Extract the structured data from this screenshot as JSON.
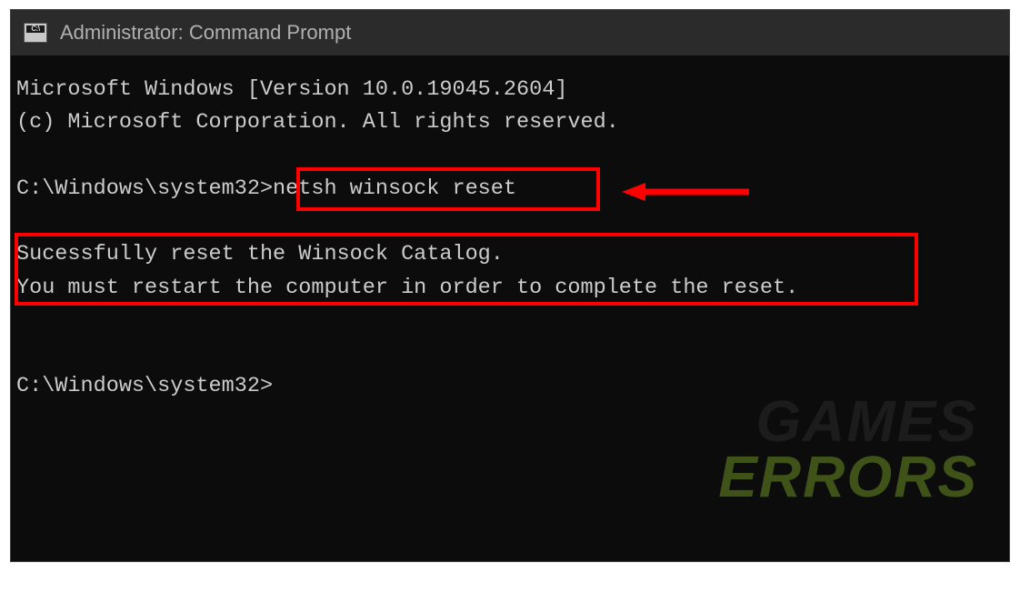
{
  "titlebar": {
    "icon_label": "C:\\",
    "title": "Administrator: Command Prompt"
  },
  "terminal": {
    "line1": "Microsoft Windows [Version 10.0.19045.2604]",
    "line2": "(c) Microsoft Corporation. All rights reserved.",
    "prompt1_path": "C:\\Windows\\system32>",
    "command": "netsh winsock reset",
    "output_line1": "Sucessfully reset the Winsock Catalog.",
    "output_line2": "You must restart the computer in order to complete the reset.",
    "prompt2_path": "C:\\Windows\\system32>"
  },
  "watermark": {
    "line1": "GAMES",
    "line2": "ERRORS"
  },
  "annotations": {
    "highlight_color": "#ff0000"
  }
}
